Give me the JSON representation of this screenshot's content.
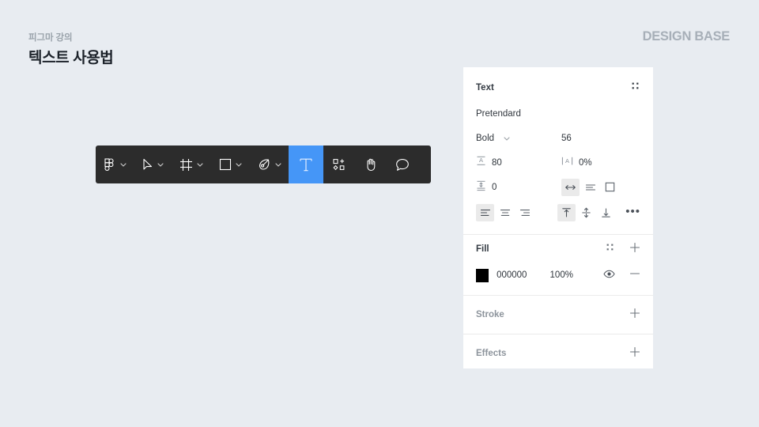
{
  "header": {
    "eyebrow": "피그마 강의",
    "title": "텍스트 사용법",
    "brand": "DESIGN BASE"
  },
  "colors": {
    "canvas_background": "#e8ecf1",
    "toolbar_background": "#2c2c2c",
    "toolbar_selected": "#4596f7",
    "panel_background": "#ffffff",
    "text_primary": "#2f353c",
    "text_muted": "#8d949c",
    "fill_swatch": "#000000"
  },
  "toolbar": {
    "name": "figma-toolbar",
    "tools": [
      {
        "id": "figma-menu",
        "icon": "figma-logo-icon",
        "caret": true,
        "selected": false
      },
      {
        "id": "move",
        "icon": "cursor-arrow-icon",
        "caret": true,
        "selected": false
      },
      {
        "id": "frame",
        "icon": "frame-icon",
        "caret": true,
        "selected": false
      },
      {
        "id": "shape",
        "icon": "rectangle-icon",
        "caret": true,
        "selected": false
      },
      {
        "id": "pen",
        "icon": "pen-icon",
        "caret": true,
        "selected": false
      },
      {
        "id": "text",
        "icon": "text-t-icon",
        "caret": false,
        "selected": true
      },
      {
        "id": "actions",
        "icon": "components-actions-icon",
        "caret": false,
        "selected": false
      },
      {
        "id": "hand",
        "icon": "hand-icon",
        "caret": false,
        "selected": false
      },
      {
        "id": "comment",
        "icon": "comment-bubble-icon",
        "caret": false,
        "selected": false
      }
    ]
  },
  "inspector": {
    "text": {
      "section_title": "Text",
      "style_icon": "style-dots-icon",
      "font_family": "Pretendard",
      "font_weight": "Bold",
      "font_size": "56",
      "line_height_icon": "line-height-icon",
      "line_height": "80",
      "letter_spacing_icon": "letter-spacing-icon",
      "letter_spacing": "0%",
      "paragraph_spacing_icon": "paragraph-spacing-icon",
      "paragraph_spacing": "0",
      "resize_options": [
        {
          "id": "auto-width",
          "icon": "auto-width-icon",
          "active": true
        },
        {
          "id": "auto-height",
          "icon": "auto-height-icon",
          "active": false
        },
        {
          "id": "fixed-size",
          "icon": "fixed-size-icon",
          "active": false
        }
      ],
      "horizontal_align": [
        {
          "id": "align-left",
          "icon": "align-left-icon",
          "active": true
        },
        {
          "id": "align-center",
          "icon": "align-center-icon",
          "active": false
        },
        {
          "id": "align-right",
          "icon": "align-right-icon",
          "active": false
        }
      ],
      "vertical_align": [
        {
          "id": "align-top",
          "icon": "align-top-icon",
          "active": true
        },
        {
          "id": "align-middle",
          "icon": "align-middle-icon",
          "active": false
        },
        {
          "id": "align-bottom",
          "icon": "align-bottom-icon",
          "active": false
        }
      ],
      "more_label": "•••"
    },
    "fill": {
      "section_title": "Fill",
      "style_icon": "style-dots-icon",
      "add_icon": "plus-icon",
      "color_hex": "000000",
      "opacity": "100%",
      "visibility_icon": "eye-icon",
      "remove_icon": "minus-icon"
    },
    "stroke": {
      "section_title": "Stroke",
      "add_icon": "plus-icon"
    },
    "effects": {
      "section_title": "Effects",
      "add_icon": "plus-icon"
    }
  }
}
